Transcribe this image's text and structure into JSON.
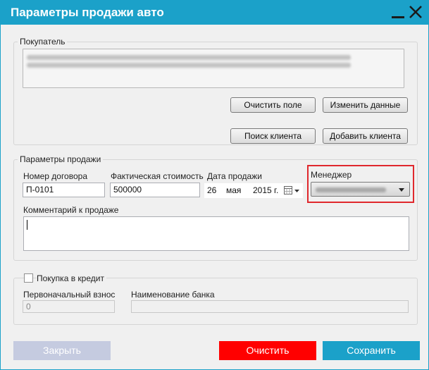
{
  "window": {
    "title": "Параметры продажи авто",
    "accent_color": "#1ba1c9",
    "minimize_icon": "minimize-icon",
    "close_icon": "close-icon"
  },
  "buyer": {
    "legend": "Покупатель",
    "info_redacted": true,
    "clear_label": "Очистить поле",
    "edit_label": "Изменить данные",
    "search_label": "Поиск клиента",
    "add_label": "Добавить клиента"
  },
  "sale": {
    "legend": "Параметры продажи",
    "contract_label": "Номер договора",
    "contract_value": "П-0101",
    "cost_label": "Фактическая стоимость",
    "cost_value": "500000",
    "date_label": "Дата продажи",
    "date_day": "26",
    "date_month": "мая",
    "date_year": "2015 г.",
    "calendar_icon": "calendar-icon",
    "manager_label": "Менеджер",
    "manager_value_redacted": true,
    "manager_highlight_color": "#e0282d",
    "comment_label": "Комментарий к продаже",
    "comment_value": ""
  },
  "credit": {
    "checkbox_label": "Покупка в кредит",
    "checked": false,
    "down_payment_label": "Первоначальный взнос",
    "down_payment_value": "0",
    "bank_label": "Наименование банка",
    "bank_value": ""
  },
  "footer": {
    "close_label": "Закрыть",
    "close_color": "#c5cbe0",
    "clear_label": "Очистить",
    "clear_color": "#ff0000",
    "save_label": "Сохранить",
    "save_color": "#1ba1c9"
  }
}
